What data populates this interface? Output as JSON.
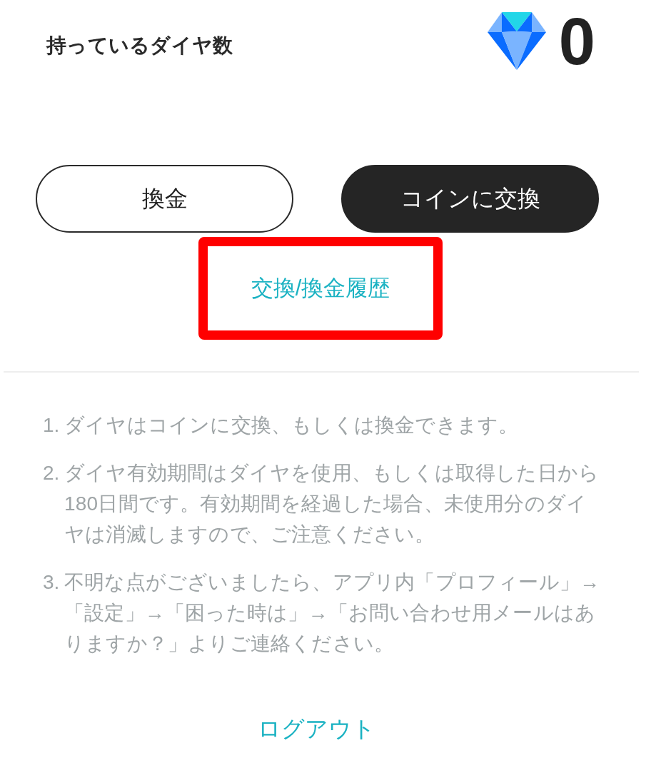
{
  "balance": {
    "label": "持っているダイヤ数",
    "amount": "0"
  },
  "actions": [
    {
      "label": "換金",
      "kind": "outline"
    },
    {
      "label": "コインに交換",
      "kind": "filled"
    }
  ],
  "history_link": {
    "label": "交換/換金履歴",
    "highlighted": true
  },
  "notes": [
    {
      "number": "1.",
      "text": "ダイヤはコインに交換、もしくは換金できます。"
    },
    {
      "number": "2.",
      "text": "ダイヤ有効期間はダイヤを使用、もしくは取得した日から180日間です。有効期間を経過した場合、未使用分のダイヤは消滅しますので、ご注意ください。"
    },
    {
      "number": "3.",
      "text": "不明な点がございましたら、アプリ内「プロフィール」→「設定」→「困った時は」→「お問い合わせ用メールはありますか？」よりご連絡ください。"
    }
  ],
  "logout": {
    "label": "ログアウト"
  }
}
